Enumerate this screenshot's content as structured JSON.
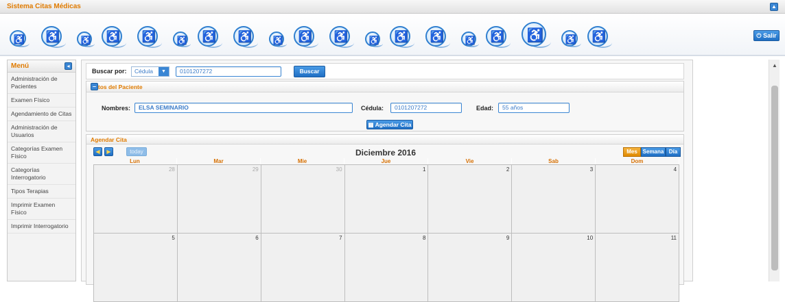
{
  "app": {
    "title": "Sistema Citas Médicas",
    "collapse_icon": "chevron-up-icon"
  },
  "header": {
    "logout_label": "Salir",
    "logout_icon": "power-icon",
    "banner_icon": "wheelchair-icon"
  },
  "sidebar": {
    "title": "Menú",
    "toggle_icon": "chevron-left-icon",
    "items": [
      {
        "label": "Administración de Pacientes"
      },
      {
        "label": "Examen Físico"
      },
      {
        "label": "Agendamiento de Citas"
      },
      {
        "label": "Administración de Usuarios"
      },
      {
        "label": "Categorías Examen Físico"
      },
      {
        "label": "Categorías Interrogatorio"
      },
      {
        "label": "Tipos Terapias"
      },
      {
        "label": "Imprimir Examen Físico"
      },
      {
        "label": "Imprimir Interrogatorio"
      }
    ]
  },
  "search": {
    "label": "Buscar por:",
    "type_value": "Cédula",
    "query_value": "0101207272",
    "button_label": "Buscar"
  },
  "patient": {
    "panel_title": "Datos del Paciente",
    "name_label": "Nombres:",
    "name_value": "ELSA SEMINARIO",
    "id_label": "Cédula:",
    "id_value": "0101207272",
    "age_label": "Edad:",
    "age_value": "55 años",
    "schedule_button": "Agendar Cita"
  },
  "calendar": {
    "panel_title": "Agendar Cita",
    "title": "Diciembre 2016",
    "today_label": "today",
    "views": [
      {
        "label": "Mes",
        "active": true
      },
      {
        "label": "Semana",
        "active": false
      },
      {
        "label": "Día",
        "active": false
      }
    ],
    "day_names": [
      "Lun",
      "Mar",
      "Mie",
      "Jue",
      "Vie",
      "Sab",
      "Dom"
    ],
    "weeks": [
      [
        {
          "day": "28",
          "other": true
        },
        {
          "day": "29",
          "other": true
        },
        {
          "day": "30",
          "other": true
        },
        {
          "day": "1"
        },
        {
          "day": "2"
        },
        {
          "day": "3"
        },
        {
          "day": "4"
        }
      ],
      [
        {
          "day": "5"
        },
        {
          "day": "6"
        },
        {
          "day": "7"
        },
        {
          "day": "8"
        },
        {
          "day": "9"
        },
        {
          "day": "10"
        },
        {
          "day": "11"
        }
      ]
    ]
  },
  "colors": {
    "accent": "#e07b00",
    "primary": "#2b7fd1",
    "active_view": "#e8920f"
  }
}
